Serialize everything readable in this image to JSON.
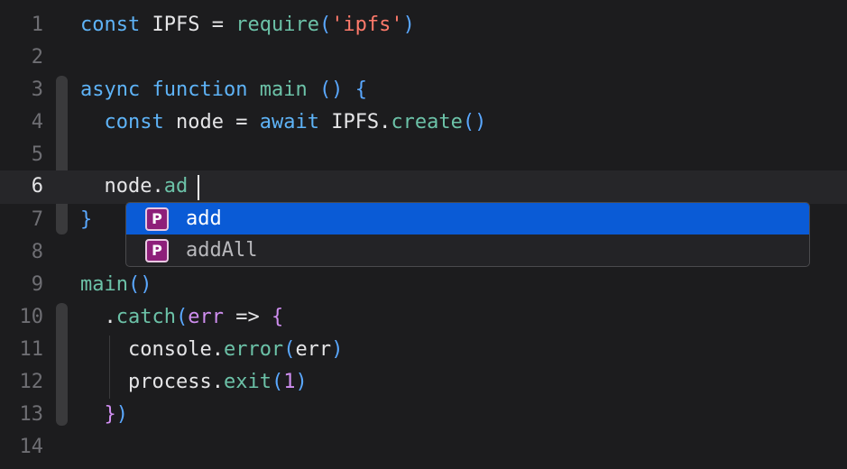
{
  "editor": {
    "line_numbers": [
      "1",
      "2",
      "3",
      "4",
      "5",
      "6",
      "7",
      "8",
      "9",
      "10",
      "11",
      "12",
      "13",
      "14"
    ],
    "current_line": "6",
    "lines": {
      "l1": [
        {
          "t": "const",
          "c": "kw"
        },
        {
          "t": " IPFS ",
          "c": "plain"
        },
        {
          "t": "=",
          "c": "op"
        },
        {
          "t": " ",
          "c": "plain"
        },
        {
          "t": "require",
          "c": "fn"
        },
        {
          "t": "(",
          "c": "paren"
        },
        {
          "t": "'ipfs'",
          "c": "str"
        },
        {
          "t": ")",
          "c": "paren"
        }
      ],
      "l3": [
        {
          "t": "async",
          "c": "kw"
        },
        {
          "t": " ",
          "c": "plain"
        },
        {
          "t": "function",
          "c": "kw"
        },
        {
          "t": " ",
          "c": "plain"
        },
        {
          "t": "main",
          "c": "fn"
        },
        {
          "t": " ",
          "c": "plain"
        },
        {
          "t": "()",
          "c": "paren"
        },
        {
          "t": " ",
          "c": "plain"
        },
        {
          "t": "{",
          "c": "paren"
        }
      ],
      "l4": [
        {
          "t": "  ",
          "c": "plain"
        },
        {
          "t": "const",
          "c": "kw"
        },
        {
          "t": " node ",
          "c": "plain"
        },
        {
          "t": "=",
          "c": "op"
        },
        {
          "t": " ",
          "c": "plain"
        },
        {
          "t": "await",
          "c": "kw"
        },
        {
          "t": " IPFS.",
          "c": "plain"
        },
        {
          "t": "create",
          "c": "fn"
        },
        {
          "t": "()",
          "c": "paren"
        }
      ],
      "l6": [
        {
          "t": "  node.",
          "c": "plain"
        },
        {
          "t": "ad",
          "c": "fn"
        }
      ],
      "l7": [
        {
          "t": "}",
          "c": "paren"
        }
      ],
      "l9": [
        {
          "t": "main",
          "c": "fn"
        },
        {
          "t": "()",
          "c": "paren"
        }
      ],
      "l10": [
        {
          "t": "  .",
          "c": "plain"
        },
        {
          "t": "catch",
          "c": "fn"
        },
        {
          "t": "(",
          "c": "paren"
        },
        {
          "t": "err",
          "c": "param"
        },
        {
          "t": " ",
          "c": "plain"
        },
        {
          "t": "=>",
          "c": "op"
        },
        {
          "t": " ",
          "c": "plain"
        },
        {
          "t": "{",
          "c": "paren2"
        }
      ],
      "l11": [
        {
          "t": "    console.",
          "c": "plain"
        },
        {
          "t": "error",
          "c": "fn"
        },
        {
          "t": "(",
          "c": "paren"
        },
        {
          "t": "err",
          "c": "plain"
        },
        {
          "t": ")",
          "c": "paren"
        }
      ],
      "l12": [
        {
          "t": "    process.",
          "c": "plain"
        },
        {
          "t": "exit",
          "c": "fn"
        },
        {
          "t": "(",
          "c": "paren"
        },
        {
          "t": "1",
          "c": "num"
        },
        {
          "t": ")",
          "c": "paren"
        }
      ],
      "l13": [
        {
          "t": "  ",
          "c": "plain"
        },
        {
          "t": "}",
          "c": "paren2"
        },
        {
          "t": ")",
          "c": "paren"
        }
      ]
    }
  },
  "completion": {
    "kind_letter": "P",
    "items": [
      {
        "label": "add",
        "kind_icon": "property-icon",
        "selected": true
      },
      {
        "label": "addAll",
        "kind_icon": "property-icon",
        "selected": false
      }
    ]
  },
  "colors": {
    "background": "#1c1c1e",
    "keyword": "#5eb3f7",
    "function": "#6cc2a8",
    "string": "#ff7a6b",
    "selection": "#0a5bd6",
    "badge": "#8e1f7a"
  }
}
